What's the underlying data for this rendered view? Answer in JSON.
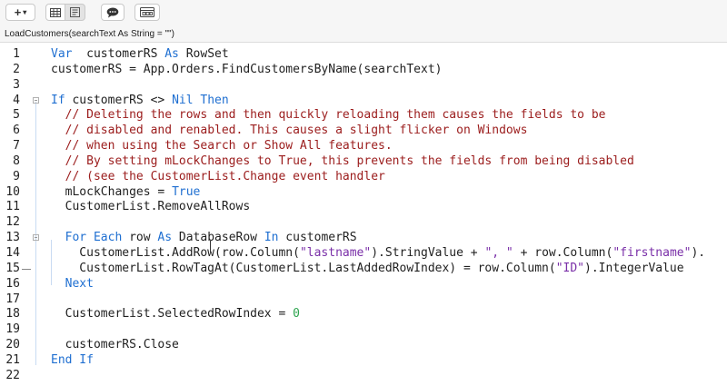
{
  "toolbar": {
    "plus_label": "+",
    "chevron": "▾"
  },
  "signature": "LoadCustomers(searchText As String = \"\")",
  "lines": [
    {
      "n": "1",
      "segs": [
        [
          "kw",
          "Var"
        ],
        [
          "",
          "  customerRS "
        ],
        [
          "kw",
          "As"
        ],
        [
          "",
          " RowSet"
        ]
      ]
    },
    {
      "n": "2",
      "segs": [
        [
          "",
          "customerRS = App.Orders.FindCustomersByName(searchText)"
        ]
      ]
    },
    {
      "n": "3",
      "segs": []
    },
    {
      "n": "4",
      "segs": [
        [
          "kw",
          "If"
        ],
        [
          "",
          " customerRS <> "
        ],
        [
          "kw",
          "Nil"
        ],
        [
          "",
          ""
        ],
        [
          "kw",
          " Then"
        ]
      ]
    },
    {
      "n": "5",
      "segs": [
        [
          "",
          "  "
        ],
        [
          "cm",
          "// Deleting the rows and then quickly reloading them causes the fields to be"
        ]
      ]
    },
    {
      "n": "6",
      "segs": [
        [
          "",
          "  "
        ],
        [
          "cm",
          "// disabled and renabled. This causes a slight flicker on Windows"
        ]
      ]
    },
    {
      "n": "7",
      "segs": [
        [
          "",
          "  "
        ],
        [
          "cm",
          "// when using the Search or Show All features."
        ]
      ]
    },
    {
      "n": "8",
      "segs": [
        [
          "",
          "  "
        ],
        [
          "cm",
          "// By setting mLockChanges to True, this prevents the fields from being disabled"
        ]
      ]
    },
    {
      "n": "9",
      "segs": [
        [
          "",
          "  "
        ],
        [
          "cm",
          "// (see the CustomerList.Change event handler"
        ]
      ]
    },
    {
      "n": "10",
      "segs": [
        [
          "",
          "  mLockChanges = "
        ],
        [
          "kw",
          "True"
        ]
      ]
    },
    {
      "n": "11",
      "segs": [
        [
          "",
          "  CustomerList.RemoveAllRows"
        ]
      ]
    },
    {
      "n": "12",
      "segs": []
    },
    {
      "n": "13",
      "segs": [
        [
          "",
          "  "
        ],
        [
          "kw",
          "For Each"
        ],
        [
          "",
          " row "
        ],
        [
          "kw",
          "As"
        ],
        [
          "",
          " DatabaseRow "
        ],
        [
          "kw",
          "In"
        ],
        [
          "",
          " customerRS"
        ]
      ]
    },
    {
      "n": "14",
      "segs": [
        [
          "",
          "    CustomerList.AddRow(row.Column("
        ],
        [
          "str",
          "\"lastname\""
        ],
        [
          "",
          ").StringValue + "
        ],
        [
          "str",
          "\", \""
        ],
        [
          "",
          " + row.Column("
        ],
        [
          "str",
          "\"firstname\""
        ],
        [
          "",
          ")."
        ]
      ]
    },
    {
      "n": "15",
      "segs": [
        [
          "",
          "    CustomerList.RowTagAt(CustomerList.LastAddedRowIndex) = row.Column("
        ],
        [
          "str",
          "\"ID\""
        ],
        [
          "",
          ").IntegerValue"
        ]
      ]
    },
    {
      "n": "16",
      "segs": [
        [
          "",
          "  "
        ],
        [
          "kw",
          "Next"
        ]
      ]
    },
    {
      "n": "17",
      "segs": []
    },
    {
      "n": "18",
      "segs": [
        [
          "",
          "  CustomerList.SelectedRowIndex = "
        ],
        [
          "num",
          "0"
        ]
      ]
    },
    {
      "n": "19",
      "segs": []
    },
    {
      "n": "20",
      "segs": [
        [
          "",
          "  customerRS.Close"
        ]
      ]
    },
    {
      "n": "21",
      "segs": [
        [
          "kw",
          "End If"
        ]
      ]
    },
    {
      "n": "22",
      "segs": []
    }
  ]
}
